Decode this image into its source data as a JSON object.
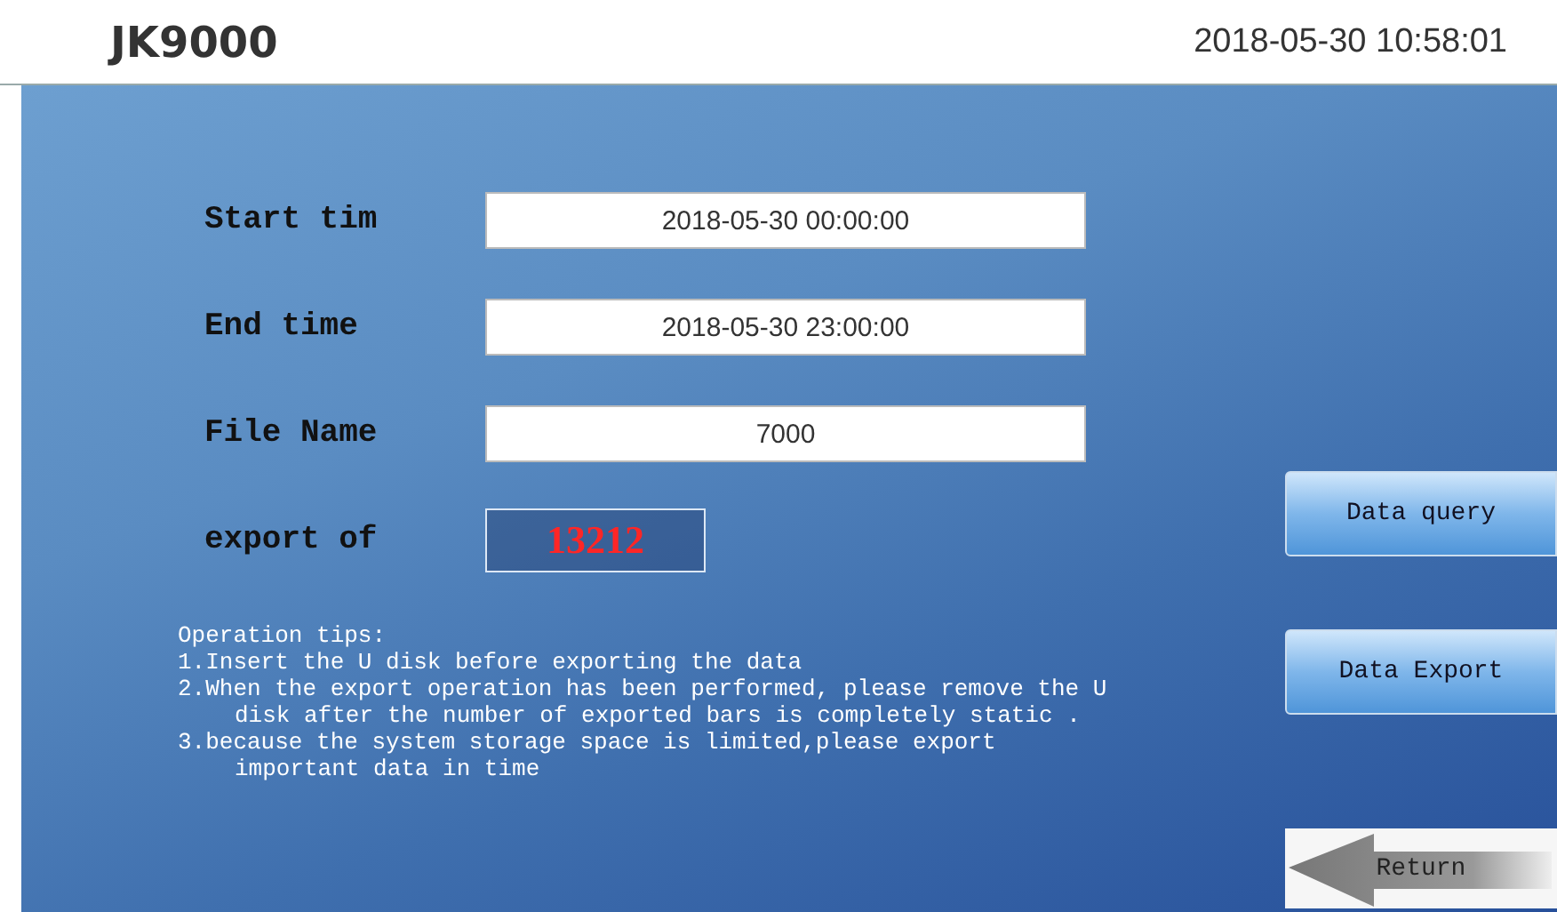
{
  "header": {
    "title": "JK9000",
    "datetime": "2018-05-30 10:58:01"
  },
  "fields": [
    {
      "label": "Start tim",
      "value": "2018-05-30 00:00:00"
    },
    {
      "label": "End time",
      "value": "2018-05-30 23:00:00"
    },
    {
      "label": "File Name",
      "value": "7000"
    }
  ],
  "export_count": {
    "label": "export of",
    "value": "13212"
  },
  "tips": {
    "title": "Operation tips:",
    "items": [
      "1.Insert the U disk before exporting the data",
      "2.When the export operation has been performed, please remove the U disk after the number of exported bars is completely static .",
      "3.because the system storage space is limited,please export important data in time"
    ]
  },
  "buttons": [
    {
      "label": "Data query",
      "kind": "action"
    },
    {
      "label": "Data Export",
      "kind": "action"
    },
    {
      "label": "Return",
      "kind": "return"
    }
  ]
}
